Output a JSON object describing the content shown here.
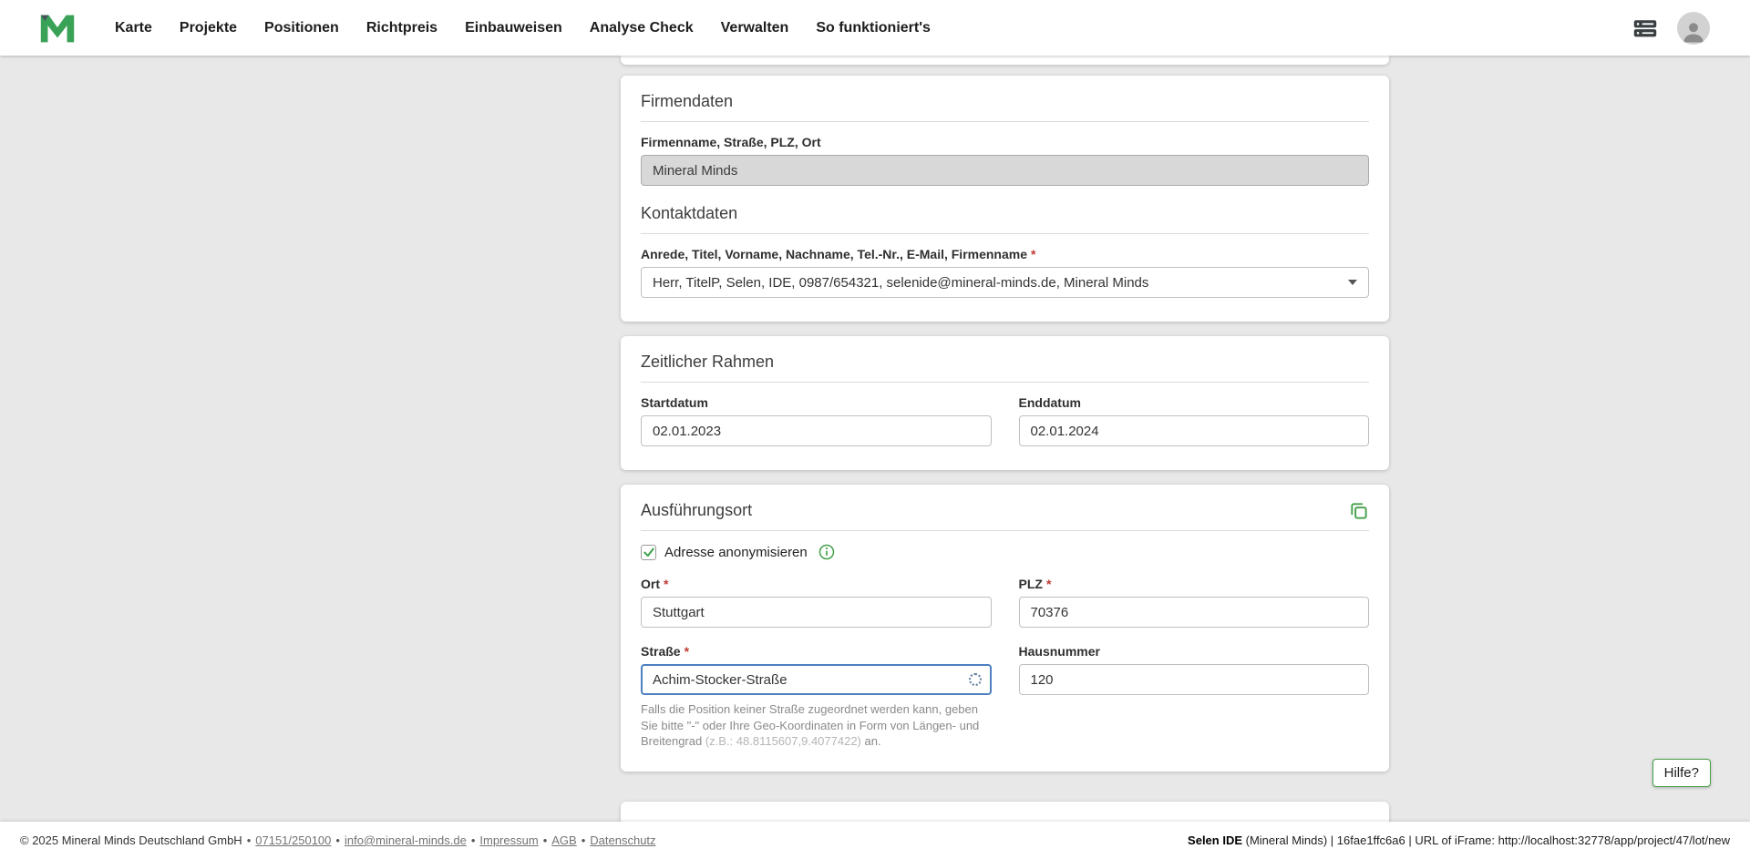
{
  "required_marker": "*",
  "colors": {
    "accent_green": "#45a049",
    "required_red": "#bf3a32",
    "focus_blue": "#4d7fc1"
  },
  "navbar": {
    "items": [
      "Karte",
      "Projekte",
      "Positionen",
      "Richtpreis",
      "Einbauweisen",
      "Analyse Check",
      "Verwalten",
      "So funktioniert's"
    ]
  },
  "firmendaten": {
    "title": "Firmendaten",
    "firma_label": "Firmenname, Straße, PLZ, Ort",
    "firma_value": "Mineral Minds",
    "kontakt_title": "Kontaktdaten",
    "kontakt_label": "Anrede, Titel, Vorname, Nachname, Tel.-Nr., E-Mail, Firmenname",
    "kontakt_value": "Herr, TitelP, Selen, IDE, 0987/654321, selenide@mineral-minds.de, Mineral Minds"
  },
  "zeitraum": {
    "title": "Zeitlicher Rahmen",
    "start_label": "Startdatum",
    "start_value": "02.01.2023",
    "end_label": "Enddatum",
    "end_value": "02.01.2024"
  },
  "ausfuehrungsort": {
    "title": "Ausführungsort",
    "anonymisieren_label": "Adresse anonymisieren",
    "ort_label": "Ort",
    "ort_value": "Stuttgart",
    "plz_label": "PLZ",
    "plz_value": "70376",
    "strasse_label": "Straße",
    "strasse_value": "Achim-Stocker-Straße",
    "hausnummer_label": "Hausnummer",
    "hausnummer_value": "120",
    "hint_text": "Falls die Position keiner Straße zugeordnet werden kann, geben Sie bitte \"-\" oder Ihre Geo-Koordinaten in Form von Längen- und Breitengrad ",
    "hint_example": "(z.B.: 48.8115607,9.4077422)",
    "hint_suffix": " an."
  },
  "help_button": {
    "label": "Hilfe?"
  },
  "footer": {
    "separator": "•",
    "copyright": "© 2025 Mineral Minds Deutschland GmbH",
    "phone": "07151/250100",
    "email": "info@mineral-minds.de",
    "impressum": "Impressum",
    "agb": "AGB",
    "datenschutz": "Datenschutz",
    "right_bold": "Selen IDE",
    "right_rest": " (Mineral Minds) | 16fae1ffc6a6 | URL of iFrame: http://localhost:32778/app/project/47/lot/new"
  }
}
